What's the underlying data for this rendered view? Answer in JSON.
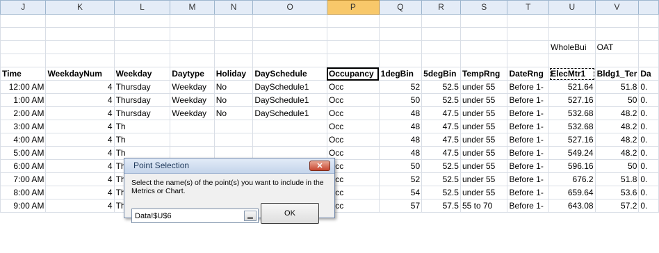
{
  "columns": [
    "J",
    "K",
    "L",
    "M",
    "N",
    "O",
    "P",
    "Q",
    "R",
    "S",
    "T",
    "U",
    "V",
    ""
  ],
  "selected_column": "P",
  "row3": {
    "U": "WholeBui",
    "V": "OAT"
  },
  "headers": [
    "Time",
    "WeekdayNum",
    "Weekday",
    "Daytype",
    "Holiday",
    "DaySchedule",
    "Occupancy",
    "1degBin",
    "5degBin",
    "TempRng",
    "DateRng",
    "ElecMtr1",
    "Bldg1_Ter",
    "Da"
  ],
  "rows": [
    [
      "12:00 AM",
      "4",
      "Thursday",
      "Weekday",
      "No",
      "DaySchedule1",
      "Occ",
      "52",
      "52.5",
      "under 55",
      "Before 1-",
      "521.64",
      "51.8",
      "0."
    ],
    [
      "1:00 AM",
      "4",
      "Thursday",
      "Weekday",
      "No",
      "DaySchedule1",
      "Occ",
      "50",
      "52.5",
      "under 55",
      "Before 1-",
      "527.16",
      "50",
      "0."
    ],
    [
      "2:00 AM",
      "4",
      "Thursday",
      "Weekday",
      "No",
      "DaySchedule1",
      "Occ",
      "48",
      "47.5",
      "under 55",
      "Before 1-",
      "532.68",
      "48.2",
      "0."
    ],
    [
      "3:00 AM",
      "4",
      "Th",
      "",
      "",
      "",
      "Occ",
      "48",
      "47.5",
      "under 55",
      "Before 1-",
      "532.68",
      "48.2",
      "0."
    ],
    [
      "4:00 AM",
      "4",
      "Th",
      "",
      "",
      "",
      "Occ",
      "48",
      "47.5",
      "under 55",
      "Before 1-",
      "527.16",
      "48.2",
      "0."
    ],
    [
      "5:00 AM",
      "4",
      "Th",
      "",
      "",
      "",
      "Occ",
      "48",
      "47.5",
      "under 55",
      "Before 1-",
      "549.24",
      "48.2",
      "0."
    ],
    [
      "6:00 AM",
      "4",
      "Th",
      "",
      "",
      "",
      "Occ",
      "50",
      "52.5",
      "under 55",
      "Before 1-",
      "596.16",
      "50",
      "0."
    ],
    [
      "7:00 AM",
      "4",
      "Th",
      "",
      "",
      "",
      "Occ",
      "52",
      "52.5",
      "under 55",
      "Before 1-",
      "676.2",
      "51.8",
      "0."
    ],
    [
      "8:00 AM",
      "4",
      "Th",
      "",
      "",
      "",
      "Occ",
      "54",
      "52.5",
      "under 55",
      "Before 1-",
      "659.64",
      "53.6",
      "0."
    ],
    [
      "9:00 AM",
      "4",
      "Thursday",
      "Weekday",
      "No",
      "DaySchedule1",
      "Occ",
      "57",
      "57.5",
      "55 to 70",
      "Before 1-",
      "643.08",
      "57.2",
      "0."
    ]
  ],
  "dialog": {
    "title": "Point Selection",
    "close_label": "✕",
    "prompt": "Select the name(s) of the point(s) you want to include in the Metrics or Chart.",
    "input_value": "Data!$U$6",
    "collapse_label": "▁",
    "ok_label": "OK"
  }
}
